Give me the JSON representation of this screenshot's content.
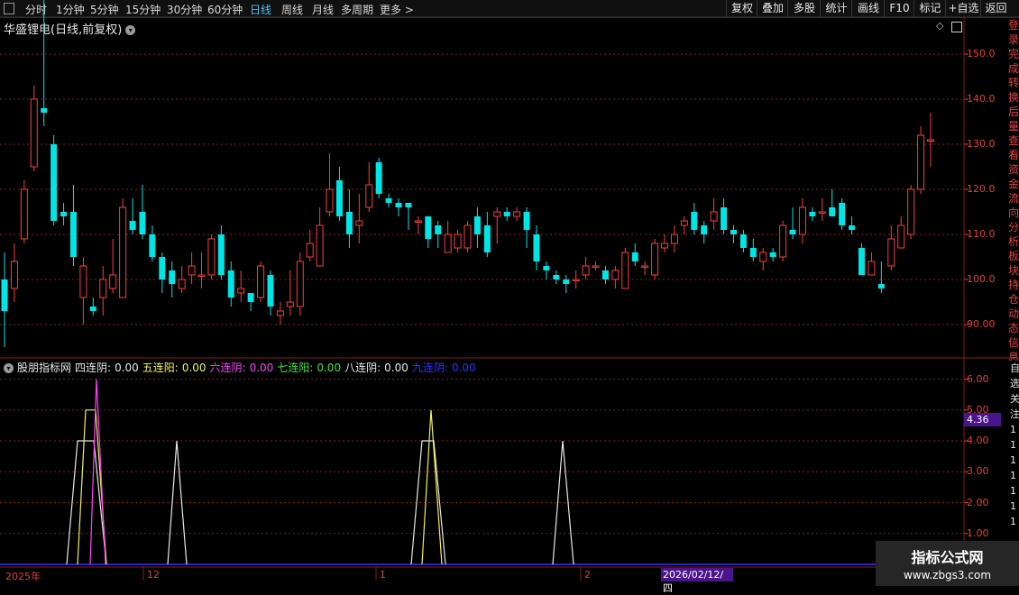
{
  "toolbar": {
    "periods": [
      "分时",
      "1分钟",
      "5分钟",
      "15分钟",
      "30分钟",
      "60分钟",
      "日线",
      "周线",
      "月线",
      "多周期",
      "更多 >"
    ],
    "active_period": "日线",
    "actions": [
      "复权",
      "叠加",
      "多股",
      "统计",
      "画线",
      "F10",
      "标记",
      "+自选",
      "返回"
    ]
  },
  "stock": {
    "title": "华盛锂电(日线,前复权)"
  },
  "price_axis": {
    "labels": [
      "150.0",
      "140.0",
      "130.0",
      "120.0",
      "110.0",
      "100.0",
      "90.00"
    ]
  },
  "side_text": "登录完成转换后量查看资金流向分析板块持仓动态信息",
  "indicator": {
    "name": "股朋指标网",
    "items": [
      {
        "label": "四连阴:",
        "value": "0.00",
        "color": "#e8e8e8"
      },
      {
        "label": "五连阳:",
        "value": "0.00",
        "color": "#f2f25a"
      },
      {
        "label": "六连阴:",
        "value": "0.00",
        "color": "#ff40ff"
      },
      {
        "label": "七连阳:",
        "value": "0.00",
        "color": "#40e040"
      },
      {
        "label": "八连阴:",
        "value": "0.00",
        "color": "#e8e8e8"
      },
      {
        "label": "九连阴:",
        "value": "0.00",
        "color": "#3030ff"
      }
    ],
    "axis_labels": [
      "6.00",
      "5.00",
      "4.00",
      "3.00",
      "2.00",
      "1.00"
    ],
    "current_value": "4.36",
    "side_text": "自选关注1111111"
  },
  "date_axis": {
    "labels": [
      "2025年",
      "12",
      "1",
      "2"
    ],
    "cursor": "2026/02/12/四"
  },
  "watermark": {
    "line1": "指标公式网",
    "line2": "www.zbgs3.com"
  },
  "colors": {
    "up": "#ff3b3b",
    "down": "#00e5e5",
    "grid": "#8b1a1a",
    "accent": "#4fc3f7"
  },
  "chart_data": {
    "type": "candlestick",
    "ylim": [
      83,
      158
    ],
    "candles": [
      [
        100,
        93,
        106,
        85
      ],
      [
        98,
        104,
        108,
        95
      ],
      [
        109,
        120,
        122,
        108
      ],
      [
        125,
        140,
        143,
        124
      ],
      [
        138,
        137,
        165,
        134
      ],
      [
        130,
        113,
        132,
        112
      ],
      [
        115,
        114,
        117,
        112
      ],
      [
        115,
        105,
        121,
        103
      ],
      [
        96,
        103,
        105,
        90
      ],
      [
        94,
        93,
        96,
        92
      ],
      [
        96,
        100,
        103,
        92
      ],
      [
        98,
        101,
        109,
        97
      ],
      [
        96,
        116,
        118,
        96
      ],
      [
        113,
        111,
        118,
        110
      ],
      [
        115,
        110,
        121,
        109
      ],
      [
        110,
        105,
        112,
        104
      ],
      [
        105,
        100,
        106,
        97
      ],
      [
        102,
        99,
        104,
        96
      ],
      [
        98,
        100,
        103,
        97
      ],
      [
        101,
        103,
        106,
        99
      ],
      [
        101,
        101,
        106,
        98
      ],
      [
        101,
        109,
        110,
        100
      ],
      [
        110,
        101,
        112,
        100
      ],
      [
        102,
        96,
        104,
        94
      ],
      [
        97,
        98,
        102,
        95
      ],
      [
        97,
        95,
        97,
        93
      ],
      [
        96,
        103,
        104,
        95
      ],
      [
        101,
        94,
        102,
        92
      ],
      [
        92,
        93,
        95,
        90
      ],
      [
        94,
        95,
        102,
        92
      ],
      [
        94,
        104,
        106,
        92
      ],
      [
        105,
        108,
        111,
        104
      ],
      [
        103,
        112,
        116,
        103
      ],
      [
        115,
        120,
        128,
        114
      ],
      [
        122,
        114,
        125,
        113
      ],
      [
        115,
        110,
        120,
        107
      ],
      [
        112,
        113,
        119,
        108
      ],
      [
        116,
        121,
        126,
        115
      ],
      [
        126,
        119,
        127,
        118
      ],
      [
        118,
        117,
        119,
        116
      ],
      [
        117,
        116,
        118,
        114
      ],
      [
        117,
        116,
        117,
        111
      ],
      [
        113,
        113,
        114,
        110
      ],
      [
        114,
        109,
        114,
        107
      ],
      [
        112,
        110,
        113,
        107
      ],
      [
        106,
        110,
        113,
        106
      ],
      [
        107,
        110,
        111,
        106
      ],
      [
        107,
        112,
        113,
        106
      ],
      [
        114,
        110,
        116,
        107
      ],
      [
        112,
        106,
        115,
        105
      ],
      [
        114,
        115,
        116,
        108
      ],
      [
        115,
        114,
        116,
        113
      ],
      [
        114,
        115,
        116,
        113
      ],
      [
        115,
        111,
        116,
        107
      ],
      [
        110,
        104,
        112,
        102
      ],
      [
        103,
        102,
        104,
        100
      ],
      [
        101,
        100,
        102,
        99
      ],
      [
        100,
        99,
        101,
        97
      ],
      [
        100,
        100,
        102,
        98
      ],
      [
        101,
        103,
        105,
        100
      ],
      [
        103,
        103,
        104,
        102
      ],
      [
        102,
        100,
        103,
        99
      ],
      [
        100,
        102,
        103,
        98
      ],
      [
        98,
        106,
        107,
        98
      ],
      [
        106,
        104,
        108,
        103
      ],
      [
        103,
        103,
        104,
        101
      ],
      [
        101,
        108,
        109,
        100
      ],
      [
        107,
        108,
        110,
        106
      ],
      [
        108,
        110,
        112,
        106
      ],
      [
        112,
        113,
        114,
        110
      ],
      [
        115,
        111,
        117,
        110
      ],
      [
        112,
        110,
        113,
        108
      ],
      [
        113,
        115,
        118,
        111
      ],
      [
        116,
        111,
        118,
        110
      ],
      [
        111,
        110,
        112,
        108
      ],
      [
        110,
        107,
        111,
        106
      ],
      [
        107,
        105,
        109,
        104
      ],
      [
        104,
        106,
        107,
        102
      ],
      [
        106,
        105,
        107,
        104
      ],
      [
        105,
        112,
        113,
        104
      ],
      [
        111,
        110,
        116,
        109
      ],
      [
        110,
        116,
        118,
        108
      ],
      [
        115,
        114,
        116,
        113
      ],
      [
        115,
        115,
        118,
        113
      ],
      [
        116,
        114,
        120,
        114
      ],
      [
        117,
        112,
        118,
        111
      ],
      [
        112,
        111,
        114,
        110
      ],
      [
        107,
        101,
        108,
        101
      ],
      [
        101,
        104,
        106,
        101
      ],
      [
        99,
        98,
        104,
        97
      ],
      [
        103,
        109,
        112,
        102
      ],
      [
        107,
        112,
        114,
        107
      ],
      [
        110,
        120,
        121,
        109
      ],
      [
        120,
        132,
        134,
        119
      ],
      [
        131,
        131,
        137,
        125
      ]
    ]
  }
}
